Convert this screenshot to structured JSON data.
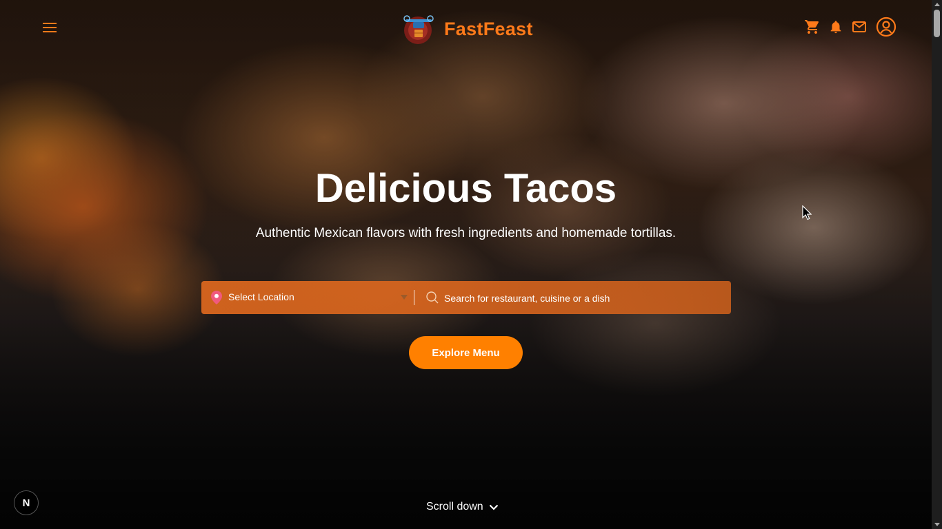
{
  "header": {
    "brand": "FastFeast",
    "icons": [
      "menu-icon",
      "cart-icon",
      "bell-icon",
      "mail-icon",
      "user-circle-icon"
    ]
  },
  "hero": {
    "title": "Delicious Tacos",
    "subtitle": "Authentic Mexican flavors with fresh ingredients and homemade tortillas.",
    "location_label": "Select Location",
    "search_placeholder": "Search for restaurant, cuisine or a dish",
    "explore_label": "Explore Menu",
    "scroll_label": "Scroll down"
  },
  "badge": {
    "letter": "N"
  },
  "colors": {
    "brand_orange": "#ff7a1a",
    "button_orange": "#ff8000",
    "search_bar": "#d9661e",
    "pin_pink": "#f05a7e",
    "white": "#ffffff"
  }
}
